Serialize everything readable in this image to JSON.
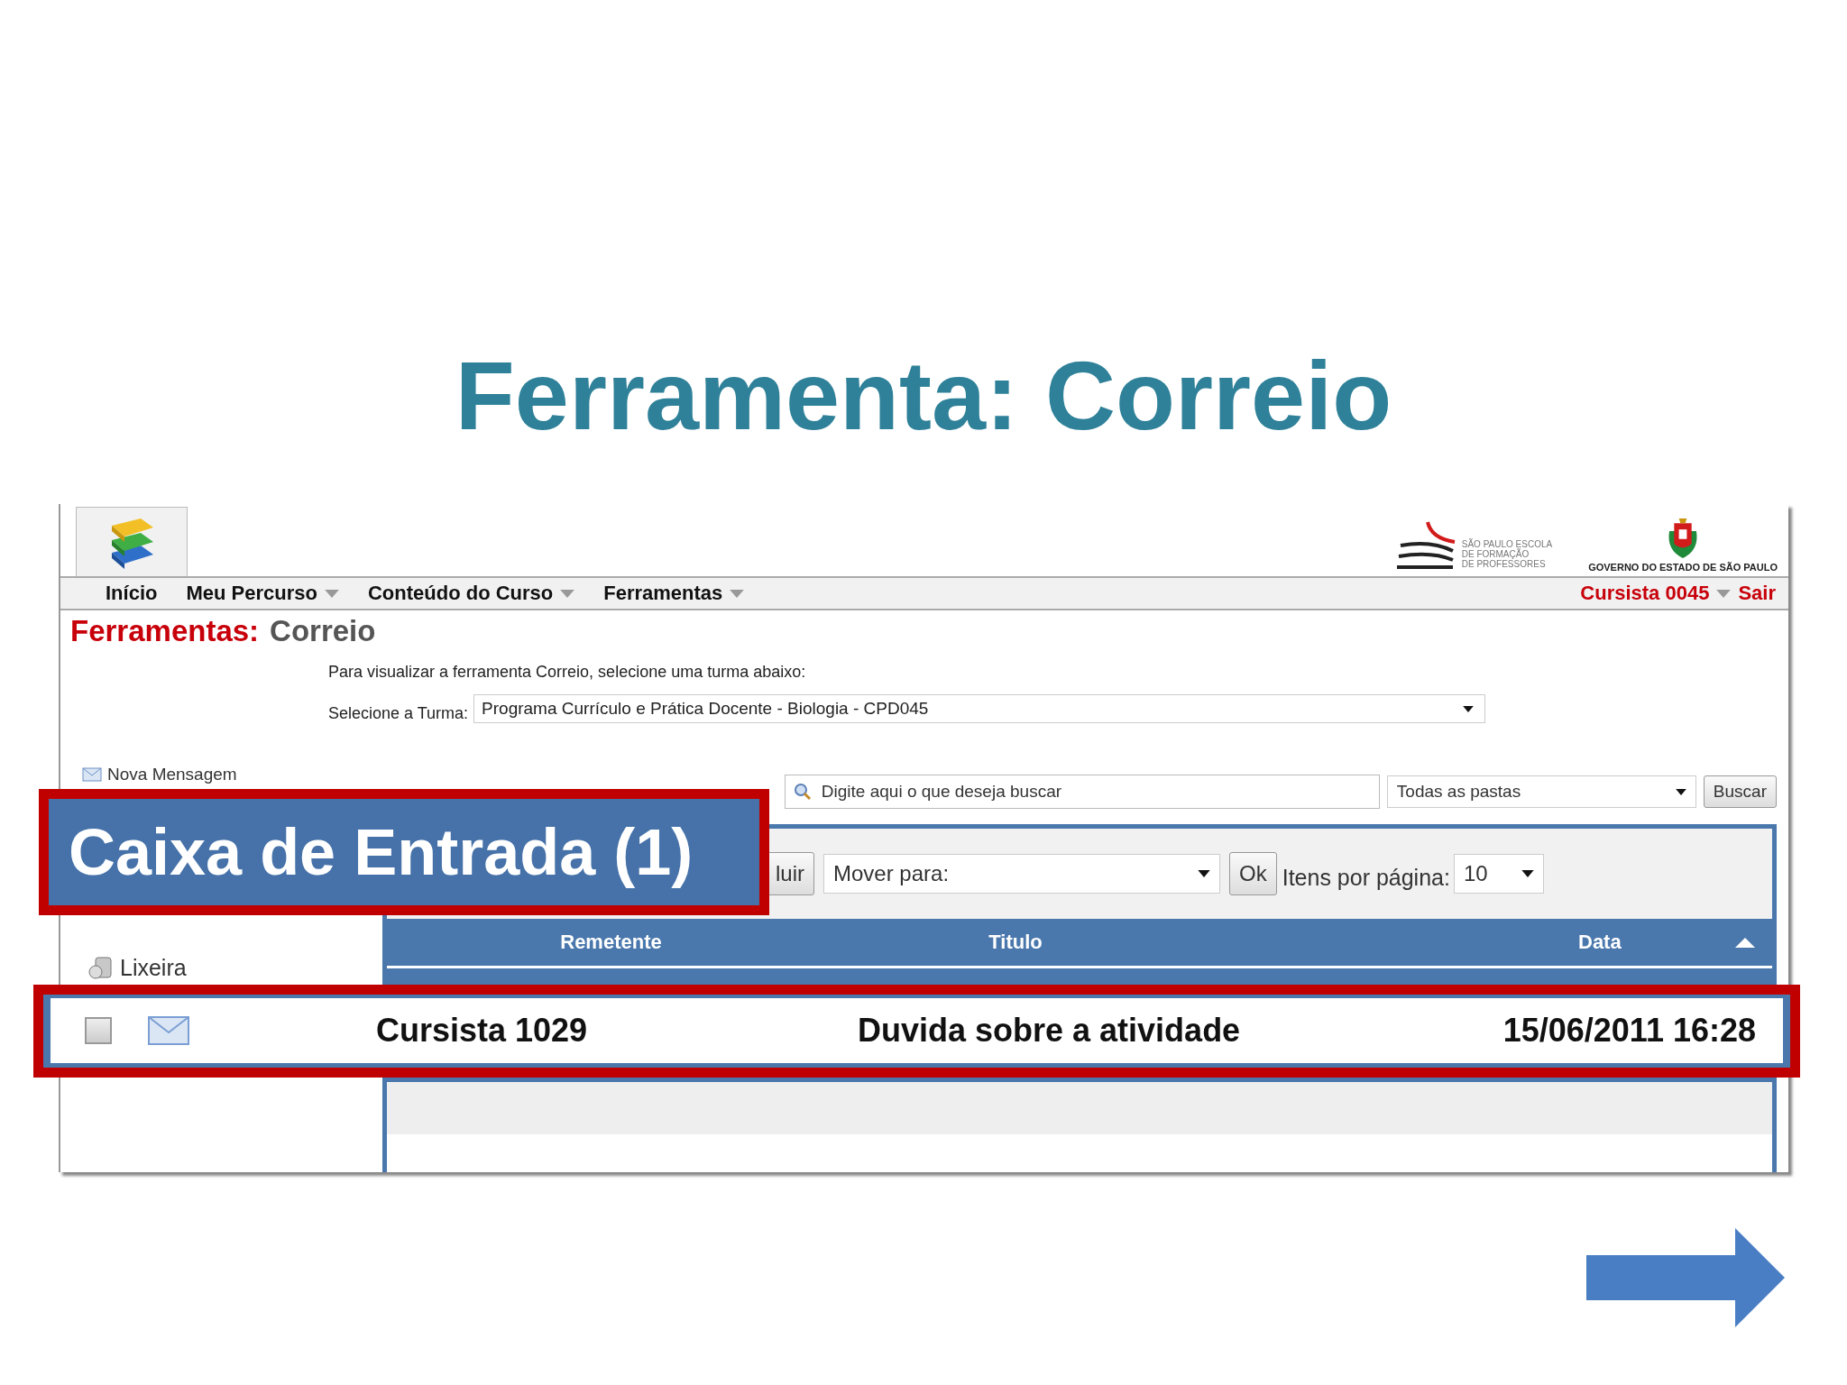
{
  "slide_title": "Ferramenta: Correio",
  "screenshot": {
    "school_logo": [
      "SÃO PAULO ESCOLA",
      "DE FORMAÇÃO",
      "DE PROFESSORES"
    ],
    "government_logo": "GOVERNO DO ESTADO DE SÃO PAULO",
    "nav": [
      {
        "label": "Início",
        "dropdown": false
      },
      {
        "label": "Meu Percurso",
        "dropdown": true
      },
      {
        "label": "Conteúdo do Curso",
        "dropdown": true
      },
      {
        "label": "Ferramentas",
        "dropdown": true
      }
    ],
    "user": {
      "name": "Cursista 0045",
      "logout": "Sair"
    },
    "page_title": {
      "section": "Ferramentas:",
      "name": "Correio"
    },
    "instruction": "Para visualizar a ferramenta Correio, selecione uma turma abaixo:",
    "class_select": {
      "label": "Selecione a Turma:",
      "value": "Programa Currículo e Prática Docente - Biologia - CPD045"
    },
    "sidebar": [
      {
        "label": "Nova Mensagem",
        "kind": "new"
      },
      {
        "label": "Lixeira",
        "kind": "trash"
      }
    ],
    "search": {
      "placeholder": "Digite aqui o que deseja buscar",
      "folder": "Todas as pastas",
      "button": "Buscar"
    },
    "toolbar": {
      "delete_button": "luir",
      "move_select": "Mover para:",
      "ok_button": "Ok",
      "per_page_label": "Itens por página:",
      "per_page": "10"
    },
    "table": {
      "columns": [
        "Remetente",
        "Titulo",
        "Data"
      ]
    }
  },
  "callouts": {
    "folder": "Caixa de Entrada (1)",
    "message": {
      "checked": false,
      "sender": "Cursista 1029",
      "title": "Duvida sobre a atividade",
      "date": "15/06/2011 16:28"
    }
  }
}
